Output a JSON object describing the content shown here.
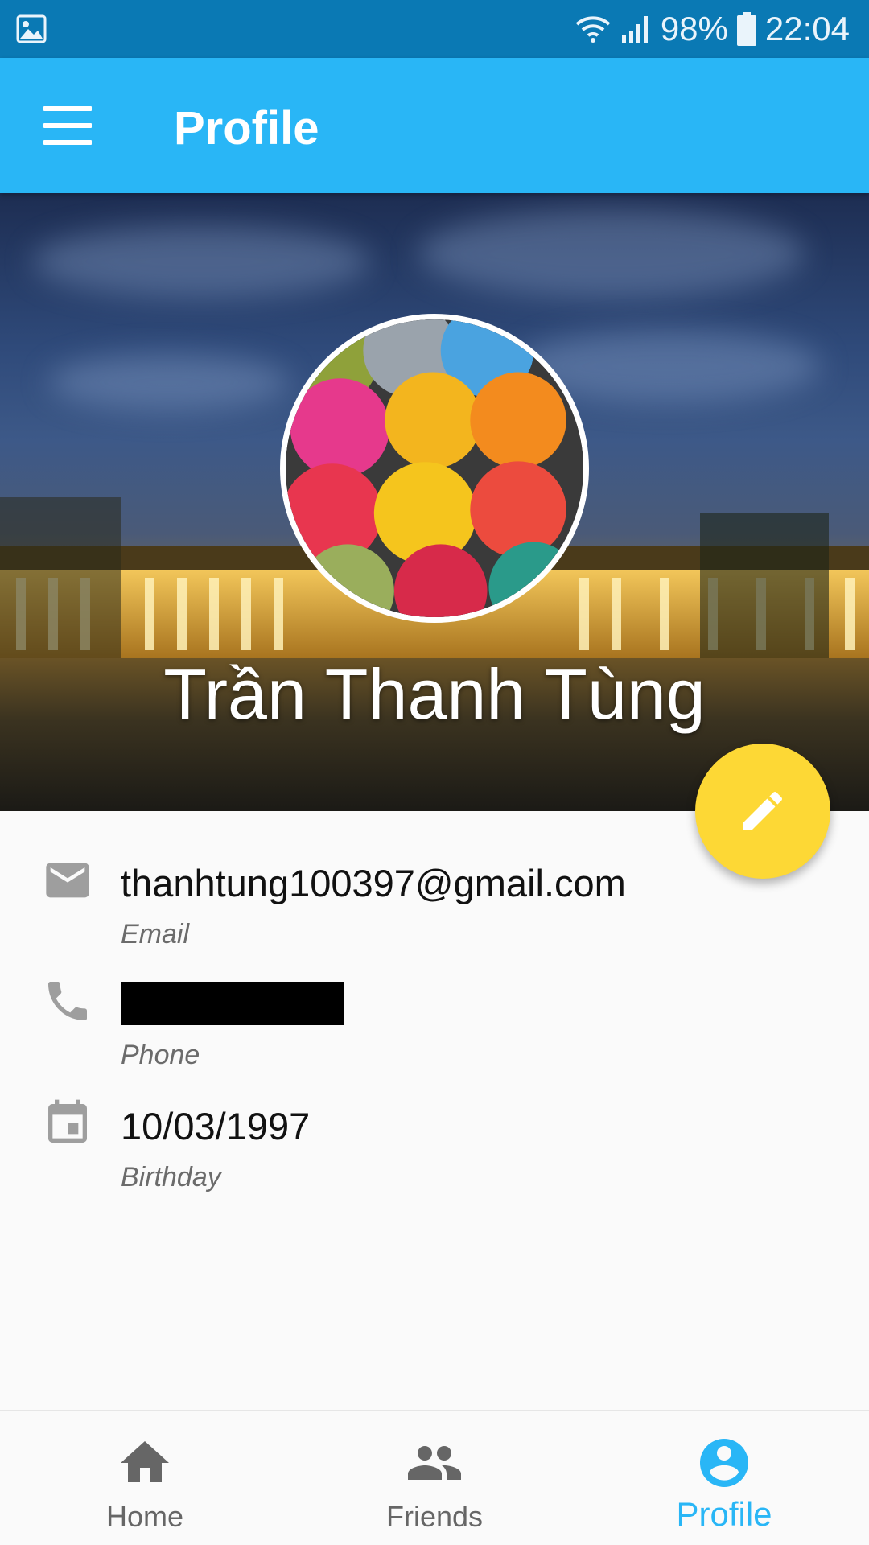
{
  "status_bar": {
    "battery": "98%",
    "time": "22:04",
    "icons": [
      "gallery-icon",
      "wifi-icon",
      "signal-icon",
      "battery-icon"
    ]
  },
  "app_bar": {
    "title": "Profile",
    "menu_icon": "menu-icon"
  },
  "header": {
    "name": "Trần Thanh Tùng",
    "avatar": "yarn-balls-photo",
    "cover": "palace-night-photo"
  },
  "fab": {
    "icon": "edit-icon",
    "color": "#fdd835"
  },
  "info": {
    "email": {
      "value": "thanhtung100397@gmail.com",
      "label": "Email",
      "icon": "email-icon"
    },
    "phone": {
      "value": "",
      "label": "Phone",
      "icon": "phone-icon"
    },
    "birthday": {
      "value": "10/03/1997",
      "label": "Birthday",
      "icon": "calendar-icon"
    }
  },
  "bottom_nav": {
    "items": [
      {
        "label": "Home",
        "icon": "home-icon"
      },
      {
        "label": "Friends",
        "icon": "friends-icon"
      },
      {
        "label": "Profile",
        "icon": "account-icon",
        "active": true
      }
    ]
  },
  "colors": {
    "status_bar": "#0a79b4",
    "primary": "#29b6f6",
    "accent": "#fdd835",
    "inactive": "#666666"
  }
}
